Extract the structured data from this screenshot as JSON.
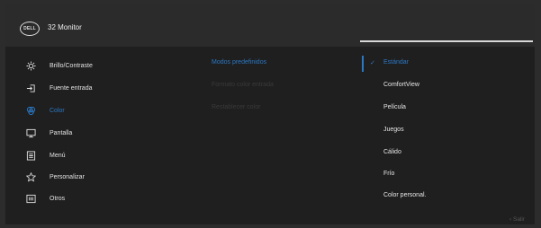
{
  "header": {
    "logo_text": "DELL",
    "title": "32 Monitor"
  },
  "menu": [
    {
      "label": "Brillo/Contraste",
      "icon": "brightness-icon"
    },
    {
      "label": "Fuente entrada",
      "icon": "input-source-icon"
    },
    {
      "label": "Color",
      "icon": "color-palette-icon",
      "active": true
    },
    {
      "label": "Pantalla",
      "icon": "display-icon"
    },
    {
      "label": "Menú",
      "icon": "menu-icon"
    },
    {
      "label": "Personalizar",
      "icon": "star-icon"
    },
    {
      "label": "Otros",
      "icon": "others-icon"
    }
  ],
  "submenu": [
    {
      "label": "Modos predefinidos",
      "state": "selected"
    },
    {
      "label": "Formato color entrada",
      "state": "disabled"
    },
    {
      "label": "Restablecer color",
      "state": "disabled"
    }
  ],
  "options": [
    {
      "label": "Estándar",
      "selected": true
    },
    {
      "label": "ComfortView"
    },
    {
      "label": "Película"
    },
    {
      "label": "Juegos"
    },
    {
      "label": "Cálido"
    },
    {
      "label": "Frío"
    },
    {
      "label": "Color personal."
    }
  ],
  "footer": {
    "back_label": "Salir"
  },
  "colors": {
    "accent": "#2b78c4",
    "panel": "#1f1f1f",
    "header": "#2b2b2b"
  }
}
